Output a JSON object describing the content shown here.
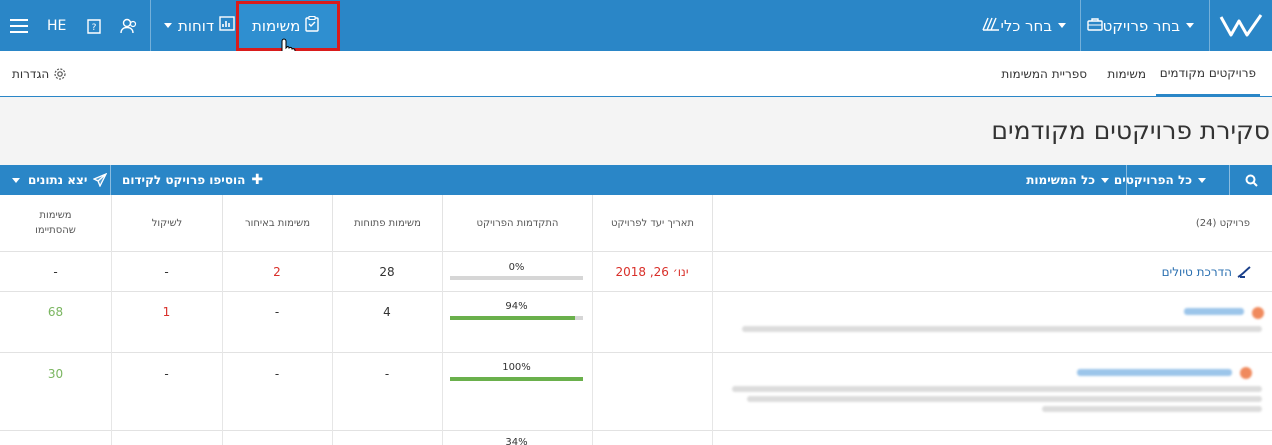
{
  "topbar": {
    "select_project": "בחר פרויקט",
    "select_tool": "בחר כלי",
    "tasks": "משימות",
    "reports": "דוחות",
    "language": "HE"
  },
  "subbar": {
    "tabs": [
      "פרויקטים מקודמים",
      "משימות",
      "ספריית המשימות"
    ],
    "settings": "הגדרות"
  },
  "page_title": "סקירת פרויקטים מקודמים",
  "toolbar": {
    "all_projects": "כל הפרויקטים",
    "all_tasks": "כל המשימות",
    "add_project": "הוסיפו פרויקט לקידום",
    "export": "יצא נתונים"
  },
  "table": {
    "headers": {
      "project": "פרויקט (24)",
      "target_date": "תאריך יעד לפרויקט",
      "progress": "התקדמות הפרויקט",
      "open_tasks": "משימות פתוחות",
      "late_tasks": "משימות באיחור",
      "to_consider": "לשיקול",
      "completed_line1": "משימות",
      "completed_line2": "שהסתיימו"
    },
    "rows": [
      {
        "name": "הדרכת טיולים",
        "date": "ינו׳ 26, 2018",
        "progress_label": "0%",
        "progress": 0,
        "open": "28",
        "late": "2",
        "consider": "-",
        "completed": "-"
      },
      {
        "name": "",
        "date": "",
        "progress_label": "94%",
        "progress": 0.94,
        "open": "4",
        "late": "-",
        "consider": "1",
        "completed": "68"
      },
      {
        "name": "",
        "date": "",
        "progress_label": "100%",
        "progress": 1.0,
        "open": "-",
        "late": "-",
        "consider": "-",
        "completed": "30"
      },
      {
        "name": "",
        "date": "",
        "progress_label": "34%",
        "progress": 0.34,
        "open": "",
        "late": "",
        "consider": "",
        "completed": ""
      }
    ]
  },
  "colors": {
    "primary": "#2a86c7",
    "highlight": "#d91b1b",
    "late": "#d9302a",
    "done": "#7bb661",
    "progress": "#6ab04c"
  }
}
